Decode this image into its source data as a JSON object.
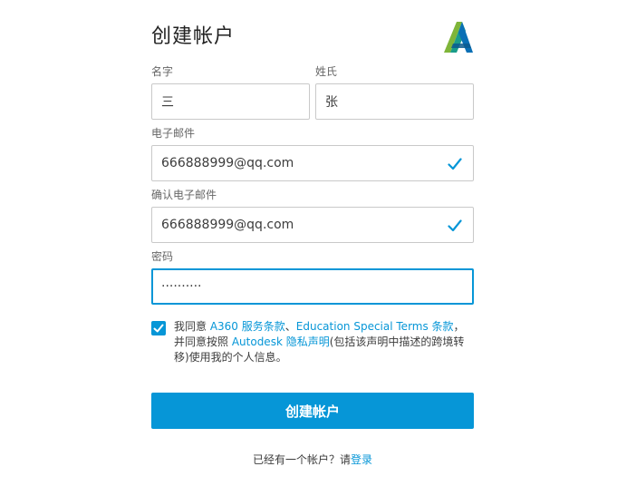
{
  "page": {
    "title": "创建帐户",
    "logo_icon": "autodesk-logo-icon"
  },
  "form": {
    "first_name": {
      "label": "名字",
      "value": "三"
    },
    "last_name": {
      "label": "姓氏",
      "value": "张"
    },
    "email": {
      "label": "电子邮件",
      "value": "666888999@qq.com",
      "status_icon": "checkmark-icon"
    },
    "confirm_email": {
      "label": "确认电子邮件",
      "value": "666888999@qq.com",
      "status_icon": "checkmark-icon"
    },
    "password": {
      "label": "密码",
      "masked_value": "··········"
    }
  },
  "agreement": {
    "checked": true,
    "part1": "我同意 ",
    "link1": "A360 服务条款",
    "sep1": "、",
    "link2": "Education Special Terms 条款",
    "part2": "，并同意按照 ",
    "link3": "Autodesk 隐私声明",
    "part3": "(包括该声明中描述的跨境转移)使用我的个人信息。"
  },
  "submit": {
    "label": "创建帐户"
  },
  "signin": {
    "prompt": "已经有一个帐户？请",
    "link": "登录"
  },
  "colors": {
    "accent": "#0696d7",
    "border": "#c9c9c9",
    "text": "#3c3c3c",
    "label": "#666666"
  }
}
